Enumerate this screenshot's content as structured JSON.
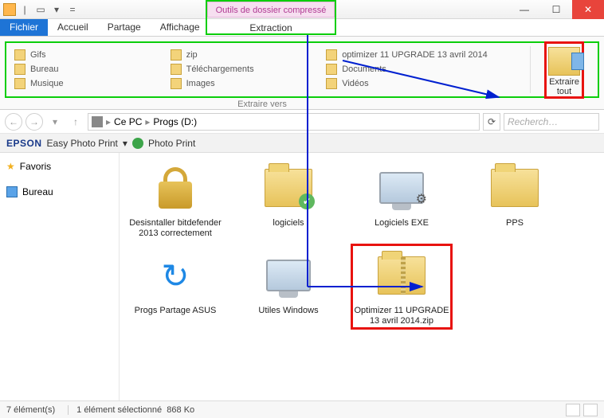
{
  "window": {
    "title": "Progs (D:)",
    "context_tab_group": "Outils de dossier compressé",
    "context_tab": "Extraction"
  },
  "tabs": {
    "file": "Fichier",
    "home": "Accueil",
    "share": "Partage",
    "view": "Affichage"
  },
  "ribbon": {
    "col1": [
      "Gifs",
      "Bureau",
      "Musique"
    ],
    "col2": [
      "zip",
      "Téléchargements",
      "Images"
    ],
    "col3": [
      "optimizer 11 UPGRADE 13 avril 2014",
      "Documents",
      "Vidéos"
    ],
    "caption": "Extraire vers",
    "extract_all_1": "Extraire",
    "extract_all_2": "tout"
  },
  "breadcrumb": {
    "root_icon": "pc",
    "seg1": "Ce PC",
    "seg2": "Progs (D:)"
  },
  "search": {
    "placeholder": "Recherch…"
  },
  "epson": {
    "brand": "EPSON",
    "easy": "Easy Photo Print",
    "photo": "Photo Print"
  },
  "nav": {
    "favorites": "Favoris",
    "desktop": "Bureau"
  },
  "files": [
    {
      "name": "Desisntaller bitdefender 2013 correctement",
      "icon": "lock"
    },
    {
      "name": "logiciels",
      "icon": "folder-check"
    },
    {
      "name": "Logiciels EXE",
      "icon": "monitor-exe"
    },
    {
      "name": "PPS",
      "icon": "folder"
    },
    {
      "name": "Progs Partage ASUS",
      "icon": "sync"
    },
    {
      "name": "Utiles Windows",
      "icon": "monitor"
    },
    {
      "name": "Optimizer 11 UPGRADE 13 avril 2014.zip",
      "icon": "zip",
      "selected": true
    }
  ],
  "status": {
    "count": "7 élément(s)",
    "selection": "1 élément sélectionné",
    "size": "868 Ko"
  }
}
